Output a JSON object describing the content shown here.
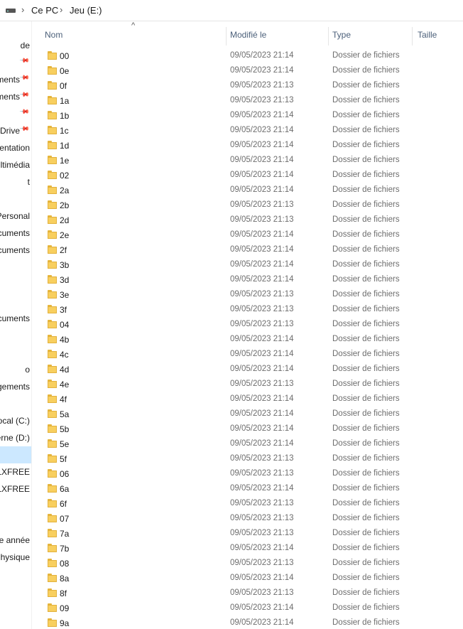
{
  "address": {
    "drive_icon": "drive-icon",
    "chevron": "›",
    "crumbs": [
      "Ce PC",
      "Jeu (E:)"
    ]
  },
  "nav": {
    "items": [
      {
        "label": "de",
        "pinned": false
      },
      {
        "label": "",
        "pinned": true
      },
      {
        "label": "chargements",
        "pinned": true
      },
      {
        "label": "Documents",
        "pinned": true
      },
      {
        "label": "",
        "pinned": true
      },
      {
        "label": "OneDrive",
        "pinned": true
      },
      {
        "label": "Projet de expérimentation",
        "pinned": false
      },
      {
        "label": "Projet de multimédia",
        "pinned": false
      },
      {
        "label": "t",
        "pinned": false
      },
      {
        "label": "",
        "pinned": false
      },
      {
        "label": "OneDrive - Personal",
        "pinned": false
      },
      {
        "label": "Documents",
        "pinned": false
      },
      {
        "label": "Documents",
        "pinned": false
      },
      {
        "label": "",
        "pinned": false
      },
      {
        "label": "",
        "pinned": false
      },
      {
        "label": "",
        "pinned": false
      },
      {
        "label": "Documents",
        "pinned": false
      },
      {
        "label": "",
        "pinned": false
      },
      {
        "label": "",
        "pinned": false
      },
      {
        "label": "o",
        "pinned": false
      },
      {
        "label": "Téléchargements",
        "pinned": false
      },
      {
        "label": "",
        "pinned": false
      },
      {
        "label": "Disque local (C:)",
        "pinned": false
      },
      {
        "label": "Disque externe (D:)",
        "pinned": false
      },
      {
        "label": "",
        "pinned": false,
        "selected": true
      },
      {
        "label": "CULXFREE",
        "pinned": false
      },
      {
        "label": "CULXFREE",
        "pinned": false
      },
      {
        "label": "",
        "pinned": false
      },
      {
        "label": "",
        "pinned": false
      },
      {
        "label": "me année",
        "pinned": false
      },
      {
        "label": "Physique",
        "pinned": false
      }
    ]
  },
  "columns": {
    "name": "Nom",
    "modified": "Modifié le",
    "type": "Type",
    "size": "Taille",
    "sort_glyph": "^"
  },
  "rows": [
    {
      "name": "00",
      "date": "09/05/2023 21:14",
      "type": "Dossier de fichiers"
    },
    {
      "name": "0e",
      "date": "09/05/2023 21:14",
      "type": "Dossier de fichiers"
    },
    {
      "name": "0f",
      "date": "09/05/2023 21:13",
      "type": "Dossier de fichiers"
    },
    {
      "name": "1a",
      "date": "09/05/2023 21:13",
      "type": "Dossier de fichiers"
    },
    {
      "name": "1b",
      "date": "09/05/2023 21:14",
      "type": "Dossier de fichiers"
    },
    {
      "name": "1c",
      "date": "09/05/2023 21:14",
      "type": "Dossier de fichiers"
    },
    {
      "name": "1d",
      "date": "09/05/2023 21:14",
      "type": "Dossier de fichiers"
    },
    {
      "name": "1e",
      "date": "09/05/2023 21:14",
      "type": "Dossier de fichiers"
    },
    {
      "name": "02",
      "date": "09/05/2023 21:14",
      "type": "Dossier de fichiers"
    },
    {
      "name": "2a",
      "date": "09/05/2023 21:14",
      "type": "Dossier de fichiers"
    },
    {
      "name": "2b",
      "date": "09/05/2023 21:13",
      "type": "Dossier de fichiers"
    },
    {
      "name": "2d",
      "date": "09/05/2023 21:13",
      "type": "Dossier de fichiers"
    },
    {
      "name": "2e",
      "date": "09/05/2023 21:14",
      "type": "Dossier de fichiers"
    },
    {
      "name": "2f",
      "date": "09/05/2023 21:14",
      "type": "Dossier de fichiers"
    },
    {
      "name": "3b",
      "date": "09/05/2023 21:14",
      "type": "Dossier de fichiers"
    },
    {
      "name": "3d",
      "date": "09/05/2023 21:14",
      "type": "Dossier de fichiers"
    },
    {
      "name": "3e",
      "date": "09/05/2023 21:13",
      "type": "Dossier de fichiers"
    },
    {
      "name": "3f",
      "date": "09/05/2023 21:13",
      "type": "Dossier de fichiers"
    },
    {
      "name": "04",
      "date": "09/05/2023 21:13",
      "type": "Dossier de fichiers"
    },
    {
      "name": "4b",
      "date": "09/05/2023 21:14",
      "type": "Dossier de fichiers"
    },
    {
      "name": "4c",
      "date": "09/05/2023 21:14",
      "type": "Dossier de fichiers"
    },
    {
      "name": "4d",
      "date": "09/05/2023 21:14",
      "type": "Dossier de fichiers"
    },
    {
      "name": "4e",
      "date": "09/05/2023 21:13",
      "type": "Dossier de fichiers"
    },
    {
      "name": "4f",
      "date": "09/05/2023 21:14",
      "type": "Dossier de fichiers"
    },
    {
      "name": "5a",
      "date": "09/05/2023 21:14",
      "type": "Dossier de fichiers"
    },
    {
      "name": "5b",
      "date": "09/05/2023 21:14",
      "type": "Dossier de fichiers"
    },
    {
      "name": "5e",
      "date": "09/05/2023 21:14",
      "type": "Dossier de fichiers"
    },
    {
      "name": "5f",
      "date": "09/05/2023 21:13",
      "type": "Dossier de fichiers"
    },
    {
      "name": "06",
      "date": "09/05/2023 21:13",
      "type": "Dossier de fichiers"
    },
    {
      "name": "6a",
      "date": "09/05/2023 21:14",
      "type": "Dossier de fichiers"
    },
    {
      "name": "6f",
      "date": "09/05/2023 21:13",
      "type": "Dossier de fichiers"
    },
    {
      "name": "07",
      "date": "09/05/2023 21:13",
      "type": "Dossier de fichiers"
    },
    {
      "name": "7a",
      "date": "09/05/2023 21:13",
      "type": "Dossier de fichiers"
    },
    {
      "name": "7b",
      "date": "09/05/2023 21:14",
      "type": "Dossier de fichiers"
    },
    {
      "name": "08",
      "date": "09/05/2023 21:13",
      "type": "Dossier de fichiers"
    },
    {
      "name": "8a",
      "date": "09/05/2023 21:14",
      "type": "Dossier de fichiers"
    },
    {
      "name": "8f",
      "date": "09/05/2023 21:13",
      "type": "Dossier de fichiers"
    },
    {
      "name": "09",
      "date": "09/05/2023 21:14",
      "type": "Dossier de fichiers"
    },
    {
      "name": "9a",
      "date": "09/05/2023 21:14",
      "type": "Dossier de fichiers"
    }
  ]
}
